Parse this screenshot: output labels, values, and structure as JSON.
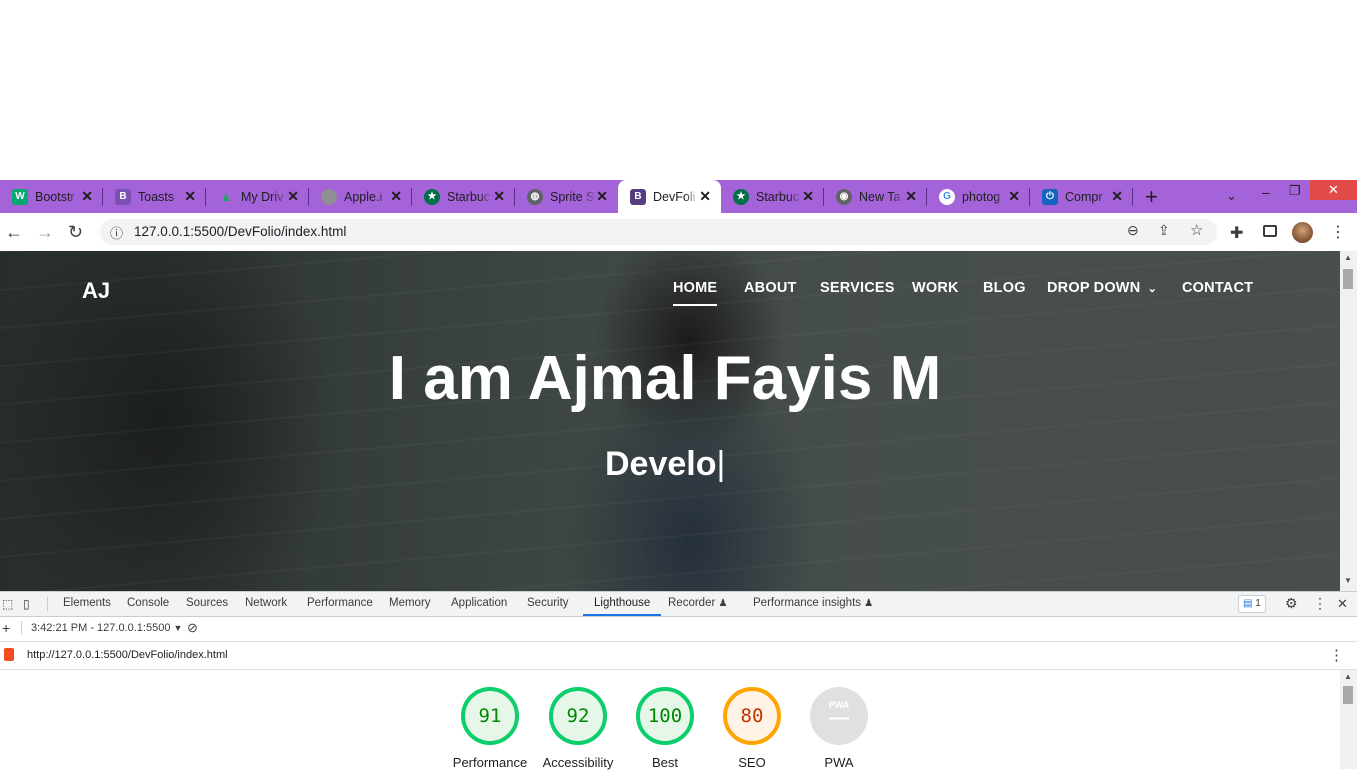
{
  "browser": {
    "tabs": [
      {
        "label": "Bootstr",
        "icon": "w3schools-icon",
        "color": "#04aa6d",
        "glyph": "W"
      },
      {
        "label": "Toasts",
        "icon": "bootstrap-icon",
        "color": "#7952b3",
        "glyph": "B"
      },
      {
        "label": "My Driv",
        "icon": "google-drive-icon",
        "color": "#1fa463",
        "glyph": "▲"
      },
      {
        "label": "Apple.i",
        "icon": "apple-icon",
        "color": "#8e8e93",
        "glyph": ""
      },
      {
        "label": "Starbuc",
        "icon": "starbucks-icon",
        "color": "#00704a",
        "glyph": "★"
      },
      {
        "label": "Sprite S",
        "icon": "globe-icon",
        "color": "#5f6368",
        "glyph": "◍"
      },
      {
        "label": "DevFoli",
        "icon": "bootstrap-icon",
        "color": "#563d7c",
        "glyph": "B"
      },
      {
        "label": "Starbuc",
        "icon": "starbucks-icon",
        "color": "#00704a",
        "glyph": "★"
      },
      {
        "label": "New Ta",
        "icon": "chrome-icon",
        "color": "#5f6368",
        "glyph": "◉"
      },
      {
        "label": "photog",
        "icon": "google-icon",
        "color": "#4285f4",
        "glyph": "G"
      },
      {
        "label": "Compr",
        "icon": "compress-icon",
        "color": "#1565c0",
        "glyph": "⏻"
      }
    ],
    "active_tab_index": 6,
    "new_tab_symbol": "+",
    "url": "127.0.0.1:5500/DevFolio/index.html"
  },
  "site": {
    "brand": "AJ",
    "nav": [
      "HOME",
      "ABOUT",
      "SERVICES",
      "WORK",
      "BLOG",
      "DROP DOWN",
      "CONTACT"
    ],
    "hero_title": "I am Ajmal Fayis M",
    "hero_subtitle": "Develo",
    "hero_caret": "|"
  },
  "devtools": {
    "tabs": [
      "Elements",
      "Console",
      "Sources",
      "Network",
      "Performance",
      "Memory",
      "Application",
      "Security",
      "Lighthouse",
      "Recorder",
      "Performance insights"
    ],
    "active_tab": "Lighthouse",
    "issues_count": "1",
    "report_time": "3:42:21 PM - 127.0.0.1:5500",
    "report_url": "http://127.0.0.1:5500/DevFolio/index.html",
    "scores": [
      {
        "value": "91",
        "label": "Performance",
        "level": 91
      },
      {
        "value": "92",
        "label": "Accessibility",
        "level": 92
      },
      {
        "value": "100",
        "label": "Best",
        "level": 100
      },
      {
        "value": "80",
        "label": "SEO",
        "level": 80
      }
    ],
    "pwa": {
      "badge": "PWA",
      "value": "—",
      "label": "PWA"
    }
  }
}
